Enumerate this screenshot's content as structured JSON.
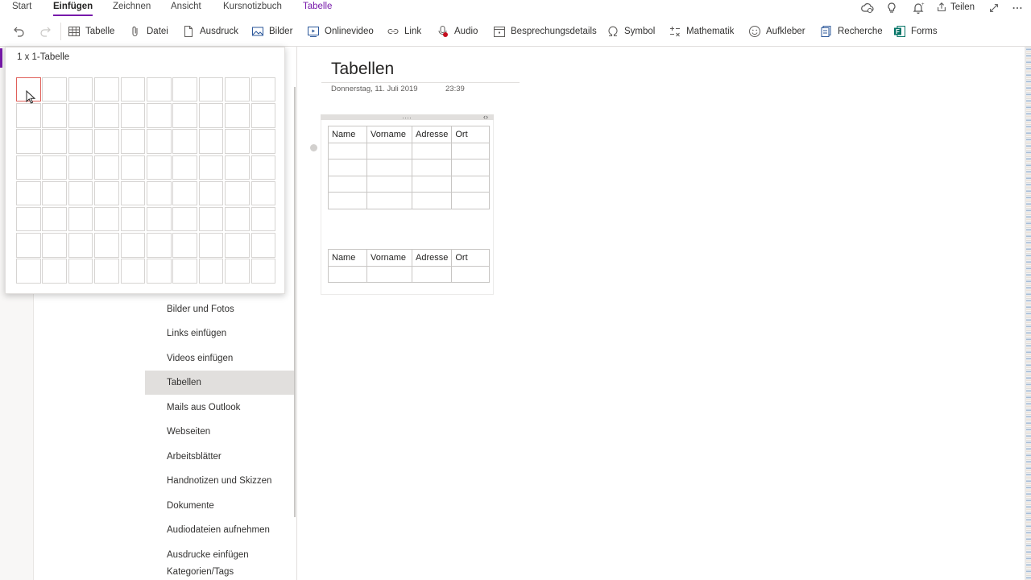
{
  "tabs": [
    {
      "label": "Start",
      "active": false
    },
    {
      "label": "Einfügen",
      "active": true
    },
    {
      "label": "Zeichnen",
      "active": false
    },
    {
      "label": "Ansicht",
      "active": false
    },
    {
      "label": "Kursnotizbuch",
      "active": false
    },
    {
      "label": "Tabelle",
      "context": true
    }
  ],
  "top_right": {
    "share_label": "Teilen"
  },
  "ribbon": {
    "buttons": [
      {
        "label": "Tabelle",
        "icon": "table-icon"
      },
      {
        "label": "Datei",
        "icon": "paperclip-icon"
      },
      {
        "label": "Ausdruck",
        "icon": "document-icon"
      },
      {
        "label": "Bilder",
        "icon": "picture-icon"
      },
      {
        "label": "Onlinevideo",
        "icon": "online-video-icon"
      },
      {
        "label": "Link",
        "icon": "link-icon"
      },
      {
        "label": "Audio",
        "icon": "audio-record-icon"
      },
      {
        "label": "Besprechungsdetails",
        "icon": "calendar-icon"
      },
      {
        "label": "Symbol",
        "icon": "omega-icon"
      },
      {
        "label": "Mathematik",
        "icon": "math-icon"
      },
      {
        "label": "Aufkleber",
        "icon": "smiley-icon"
      },
      {
        "label": "Recherche",
        "icon": "research-icon"
      },
      {
        "label": "Forms",
        "icon": "forms-icon"
      }
    ]
  },
  "picker": {
    "title": "1 x 1-Tabelle",
    "columns": 10,
    "rows": 8,
    "highlight_cols": 1,
    "highlight_rows": 1
  },
  "pages": [
    {
      "label": "Bilder und Fotos",
      "selected": false
    },
    {
      "label": "Links einfügen",
      "selected": false
    },
    {
      "label": "Videos einfügen",
      "selected": false
    },
    {
      "label": "Tabellen",
      "selected": true
    },
    {
      "label": "Mails aus Outlook",
      "selected": false
    },
    {
      "label": "Webseiten",
      "selected": false
    },
    {
      "label": "Arbeitsblätter",
      "selected": false
    },
    {
      "label": "Handnotizen und Skizzen",
      "selected": false
    },
    {
      "label": "Dokumente",
      "selected": false
    },
    {
      "label": "Audiodateien aufnehmen",
      "selected": false
    },
    {
      "label": "Ausdrucke einfügen",
      "selected": false
    },
    {
      "label": "Kategorien/Tags",
      "selected": false
    }
  ],
  "note": {
    "title": "Tabellen",
    "date": "Donnerstag, 11. Juli 2019",
    "time": "23:39",
    "table1": {
      "headers": [
        "Name",
        "Vorname",
        "Adresse",
        "Ort"
      ],
      "empty_rows": 4
    },
    "table2": {
      "headers": [
        "Name",
        "Vorname",
        "Adresse",
        "Ort"
      ],
      "empty_rows": 1
    }
  },
  "colors": {
    "accent": "#7719aa",
    "selected_page_bg": "#e1dfdd",
    "picker_highlight": "#e0605a",
    "forms_green": "#077568"
  }
}
